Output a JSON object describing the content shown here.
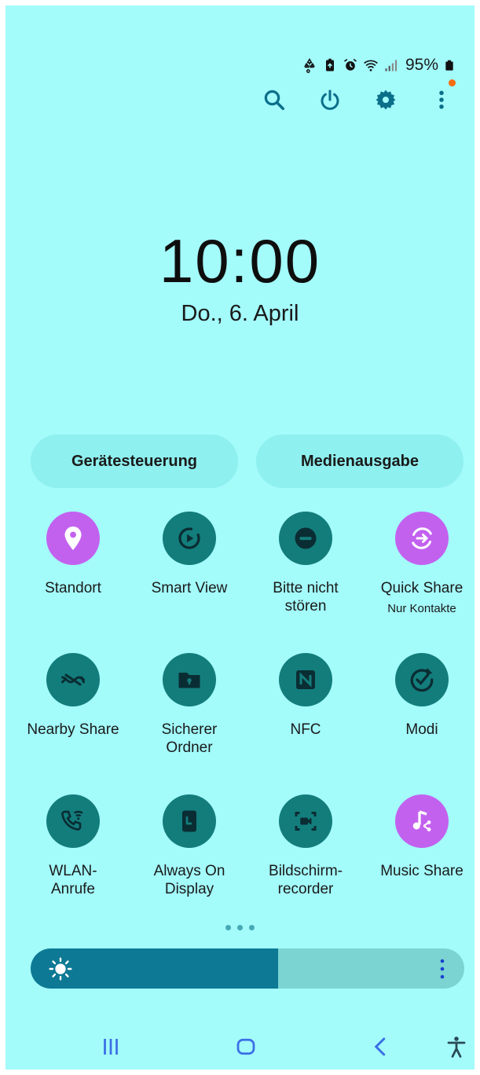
{
  "status_bar": {
    "battery_percent": "95%",
    "icons": [
      "recycle-icon",
      "battery-saver-icon",
      "alarm-icon",
      "wifi-icon",
      "signal-icon",
      "battery-icon"
    ]
  },
  "top_actions": [
    "search-icon",
    "power-icon",
    "settings-icon",
    "more-vert-icon"
  ],
  "clock": {
    "time": "10:00",
    "date": "Do., 6. April"
  },
  "pills": {
    "device_control": "Gerätesteuerung",
    "media_output": "Medienausgabe"
  },
  "tiles": [
    {
      "label": "Standort",
      "icon": "location-pin-icon",
      "active": true
    },
    {
      "label": "Smart View",
      "icon": "smart-view-icon",
      "active": false
    },
    {
      "label": "Bitte nicht stören",
      "icon": "do-not-disturb-icon",
      "active": false
    },
    {
      "label": "Quick Share",
      "sub": "Nur Kontakte",
      "icon": "quick-share-icon",
      "active": true
    },
    {
      "label": "Nearby Share",
      "icon": "nearby-share-icon",
      "active": false
    },
    {
      "label": "Sicherer Ordner",
      "icon": "secure-folder-icon",
      "active": false
    },
    {
      "label": "NFC",
      "icon": "nfc-icon",
      "active": false
    },
    {
      "label": "Modi",
      "icon": "modes-icon",
      "active": false
    },
    {
      "label": "WLAN-Anrufe",
      "icon": "wifi-calling-icon",
      "active": false
    },
    {
      "label": "Always On Display",
      "icon": "always-on-display-icon",
      "active": false
    },
    {
      "label": "Bildschirm-recorder",
      "icon": "screen-recorder-icon",
      "active": false
    },
    {
      "label": "Music Share",
      "icon": "music-share-icon",
      "active": true
    }
  ],
  "tile_labels": {
    "t0": "Standort",
    "t1": "Smart View",
    "t2a": "Bitte nicht",
    "t2b": "stören",
    "t3": "Quick Share",
    "t3sub": "Nur Kontakte",
    "t4": "Nearby Share",
    "t5a": "Sicherer",
    "t5b": "Ordner",
    "t6": "NFC",
    "t7": "Modi",
    "t8a": "WLAN-",
    "t8b": "Anrufe",
    "t9a": "Always On",
    "t9b": "Display",
    "t10a": "Bildschirm-",
    "t10b": "recorder",
    "t11": "Music Share"
  },
  "brightness": {
    "level_fraction": 0.57
  },
  "colors": {
    "background": "#a3fbfa",
    "tile_off": "#137d7c",
    "tile_on": "#c361ef",
    "brightness_fill": "#0d7995",
    "notification_dot": "#f36b12",
    "accent_icon": "#0b6f8a"
  },
  "nav_bar": [
    "recents-icon",
    "home-icon",
    "back-icon",
    "accessibility-icon"
  ]
}
